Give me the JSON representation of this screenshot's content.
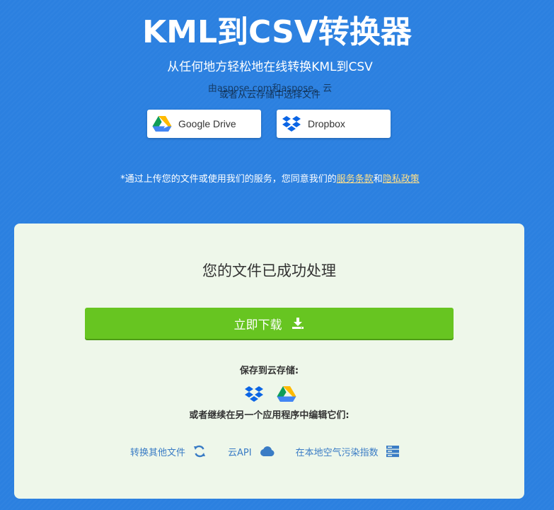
{
  "header": {
    "title": "KML到CSV转换器",
    "subtitle": "从任何地方轻松地在线转换KML到CSV",
    "by_line": "由aspose.com和aspose。云",
    "cloud_select_label": "或者从云存储中选择文件"
  },
  "cloud_buttons": [
    {
      "label": "Google Drive",
      "icon": "google-drive-icon"
    },
    {
      "label": "Dropbox",
      "icon": "dropbox-icon"
    }
  ],
  "consent": {
    "prefix": "*通过上传您的文件或使用我们的服务，您同意我们的",
    "terms_link": "服务条款",
    "and": "和",
    "privacy_link": "隐私政策"
  },
  "result": {
    "message": "您的文件已成功处理",
    "download_label": "立即下载",
    "download_icon": "download-icon",
    "save_label": "保存到云存储:",
    "save_icons": [
      "dropbox-icon",
      "google-drive-icon"
    ],
    "continue_label": "或者继续在另一个应用程序中编辑它们:",
    "app_links": [
      {
        "label": "转换其他文件",
        "icon": "refresh-icon"
      },
      {
        "label": "云API",
        "icon": "cloud-icon"
      },
      {
        "label": "在本地空气污染指数",
        "icon": "server-icon"
      }
    ]
  },
  "colors": {
    "background": "#2b80e0",
    "panel": "#eef7ea",
    "download_button": "#67c521",
    "link_accent": "#ffe08a",
    "app_link": "#3a7cc5"
  }
}
